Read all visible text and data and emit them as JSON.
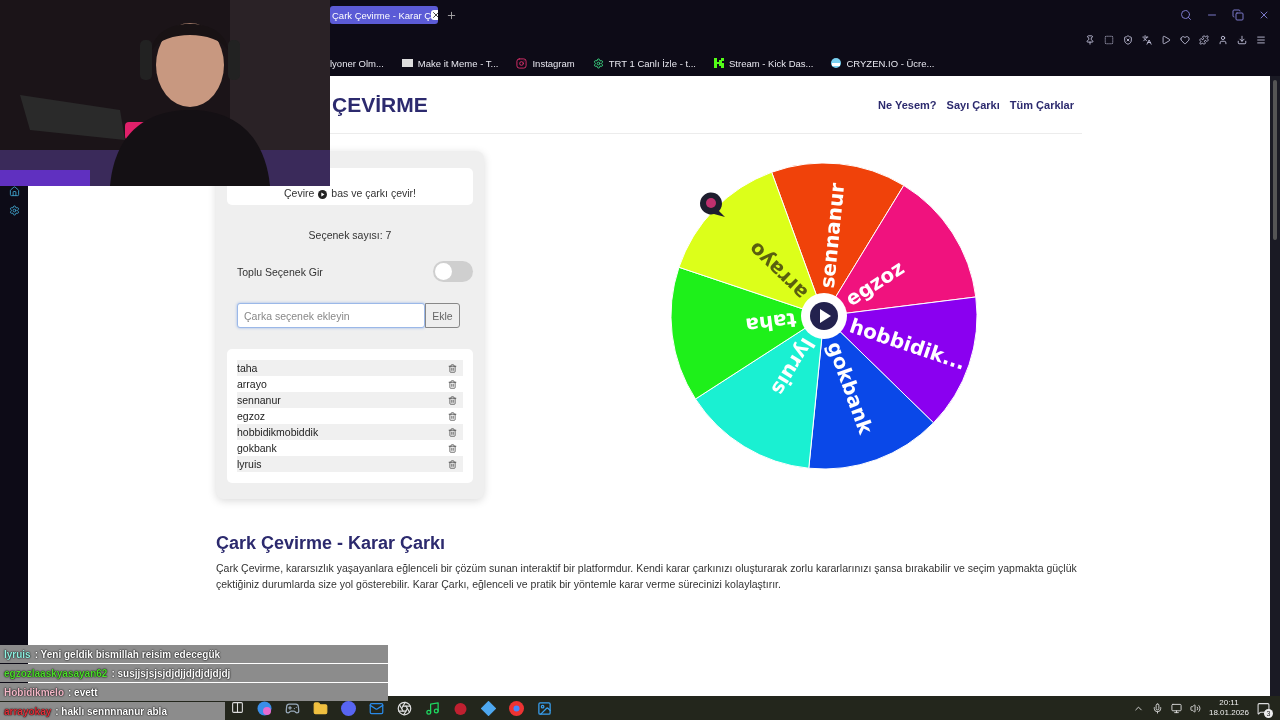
{
  "browser": {
    "tab": {
      "title": "Çark Çevirme - Karar Ç",
      "selected": true
    },
    "bookmarks": [
      {
        "label": "lyoner Olm...",
        "kind": "plain"
      },
      {
        "label": "Make it Meme - T...",
        "kind": "meme"
      },
      {
        "label": "Instagram",
        "kind": "insta"
      },
      {
        "label": "TRT 1 Canlı İzle - t...",
        "kind": "gear"
      },
      {
        "label": "Stream - Kick Das...",
        "kind": "kick"
      },
      {
        "label": "CRYZEN.IO - Ücre...",
        "kind": "ball"
      }
    ]
  },
  "site": {
    "logo": "ÇEVİRME",
    "nav": [
      "Ne Yesem?",
      "Sayı Çarkı",
      "Tüm Çarklar"
    ]
  },
  "panel": {
    "hint_before": "Çevire",
    "hint_after": "bas ve çarkı çevir!",
    "count": "Seçenek sayısı: 7",
    "bulk_toggle": {
      "label": "Toplu Seçenek Gir",
      "on": false
    },
    "input": {
      "placeholder": "Çarka seçenek ekleyin"
    },
    "add_button": "Ekle",
    "options": [
      "taha",
      "arrayo",
      "sennanur",
      "egzoz",
      "hobbidikmobiddik",
      "gokbank",
      "lyruis"
    ]
  },
  "wheel": {
    "segments": [
      {
        "label": "sennanur",
        "color": "#f0420a"
      },
      {
        "label": "egzoz",
        "color": "#f0127e"
      },
      {
        "label": "hobbidik...",
        "color": "#8a00f0"
      },
      {
        "label": "gokbank",
        "color": "#0a48e8"
      },
      {
        "label": "lyruis",
        "color": "#1af0d2"
      },
      {
        "label": "taha",
        "color": "#1ef01a"
      },
      {
        "label": "arrayo",
        "color": "#dcff1a"
      }
    ]
  },
  "article": {
    "title": "Çark Çevirme - Karar Çarkı",
    "text": "Çark Çevirme, kararsızlık yaşayanlara eğlenceli bir çözüm sunan interaktif bir platformdur. Kendi karar çarkınızı oluşturarak zorlu kararlarınızı şansa bırakabilir ve seçim yapmakta güçlük çektiğiniz durumlarda size yol gösterebilir. Karar Çarkı, eğlenceli ve pratik bir yöntemle karar verme sürecinizi kolaylaştırır."
  },
  "chat": [
    {
      "user": "lyruis",
      "color": "#8ff0e0",
      "text": ": Yeni geldik bismillah reisim edecegük"
    },
    {
      "user": "egzozlaaskyasayan62",
      "color": "#4cdc2a",
      "text": ": susjjsjsjsjdjdjjdjdjdjdjdj"
    },
    {
      "user": "Hobidikmelo",
      "color": "#f4b8c8",
      "text": ": evett"
    },
    {
      "user": "arrayokay",
      "color": "#e0303a",
      "text": ": haklı sennnnanur abla"
    }
  ],
  "taskbar": {
    "time": "20:11",
    "date": "18.01.2026",
    "notifications": "3"
  }
}
